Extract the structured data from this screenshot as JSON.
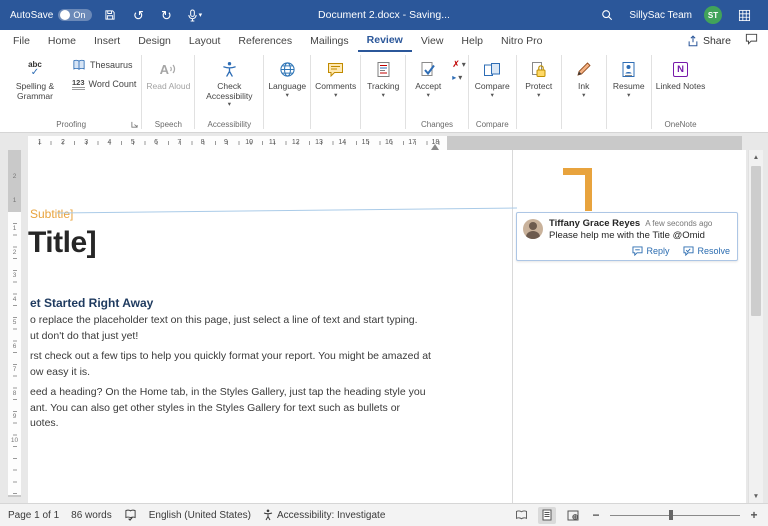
{
  "titlebar": {
    "autosave_label": "AutoSave",
    "autosave_state": "On",
    "doc_title": "Document 2.docx - Saving...",
    "account_name": "SillySac Team",
    "account_initials": "ST"
  },
  "tabs": {
    "items": [
      "File",
      "Home",
      "Insert",
      "Design",
      "Layout",
      "References",
      "Mailings",
      "Review",
      "View",
      "Help",
      "Nitro Pro"
    ],
    "share_label": "Share"
  },
  "ribbon": {
    "spelling": "Spelling & Grammar",
    "thesaurus": "Thesaurus",
    "word_count": "Word Count",
    "read_aloud": "Read Aloud",
    "check_accessibility": "Check Accessibility",
    "language": "Language",
    "comments": "Comments",
    "tracking": "Tracking",
    "accept": "Accept",
    "compare": "Compare",
    "protect": "Protect",
    "ink": "Ink",
    "resume": "Resume",
    "linked_notes": "Linked Notes",
    "groups": {
      "proofing": "Proofing",
      "speech": "Speech",
      "accessibility": "Accessibility",
      "changes": "Changes",
      "compare": "Compare",
      "onenote": "OneNote"
    }
  },
  "icons": {
    "spelling_text": "abc",
    "word_count_text": "123",
    "onenote_text": "N"
  },
  "ruler": {
    "h": [
      "1",
      "2",
      "3",
      "4",
      "5",
      "6",
      "7",
      "8",
      "9",
      "10",
      "11",
      "12",
      "13",
      "14",
      "15",
      "16",
      "17",
      "18"
    ],
    "v_margin": [
      "2",
      "1"
    ],
    "v": [
      "1",
      "2",
      "3",
      "4",
      "5",
      "6",
      "7",
      "8",
      "9",
      "10"
    ]
  },
  "document": {
    "subtitle": "Subtitle]",
    "title": "Title]",
    "heading": "et Started Right Away",
    "para1": [
      "o replace the placeholder text on this page, just select a line of text and start typing.",
      "ut don't do that just yet!"
    ],
    "para2": [
      "rst check out a few tips to help you quickly format your report. You might be amazed at",
      "ow easy it is."
    ],
    "para3": [
      "eed a heading? On the Home tab, in the Styles Gallery, just tap the heading style you",
      "ant. You can also get other styles in the Styles Gallery for text such as bullets or",
      "uotes."
    ]
  },
  "comment": {
    "author": "Tiffany Grace Reyes",
    "time": "A few seconds ago",
    "text": "Please help me with the Title @Omid",
    "reply_label": "Reply",
    "resolve_label": "Resolve"
  },
  "status": {
    "page_info": "Page 1 of 1",
    "word_count": "86 words",
    "language": "English (United States)",
    "accessibility": "Accessibility: Investigate"
  }
}
